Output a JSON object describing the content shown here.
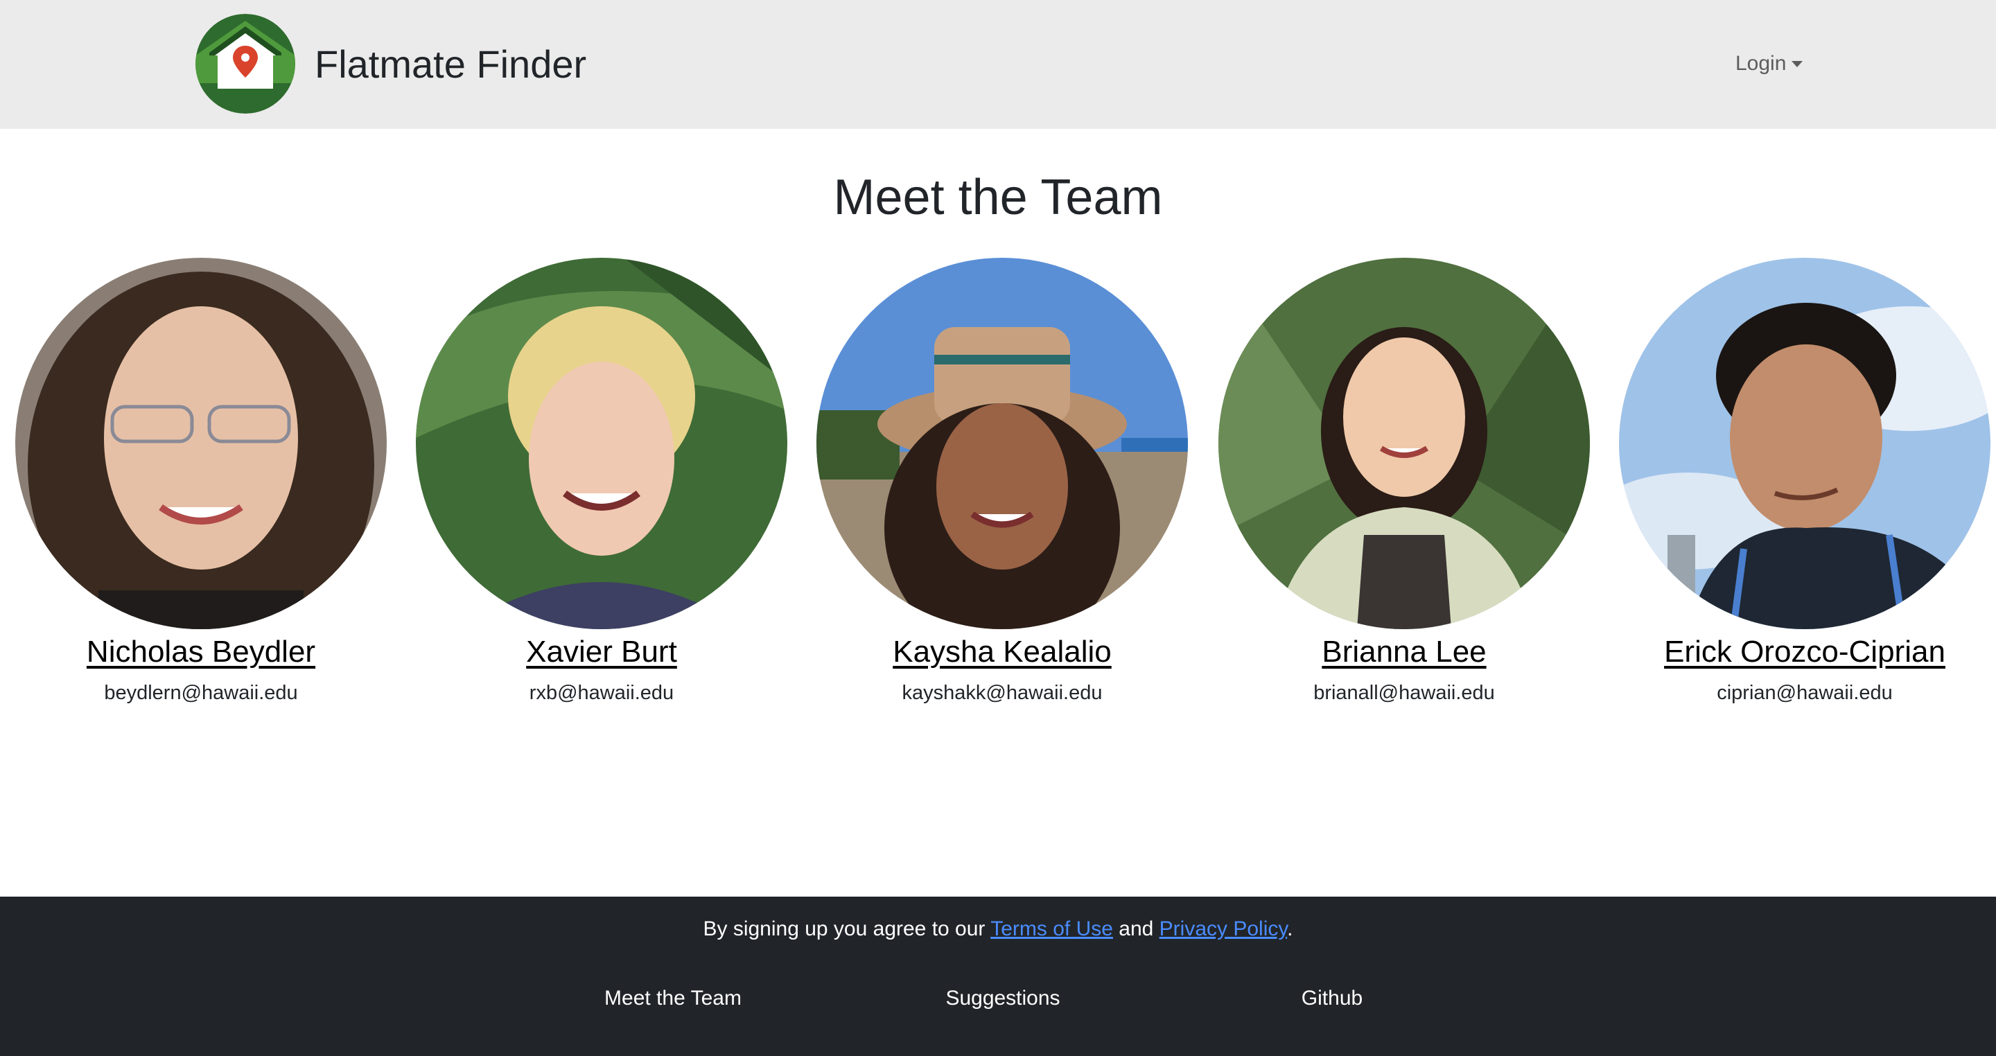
{
  "navbar": {
    "brand": "Flatmate Finder",
    "login_label": "Login"
  },
  "main": {
    "title": "Meet the Team",
    "members": [
      {
        "name": "Nicholas Beydler",
        "email": "beydlern@hawaii.edu"
      },
      {
        "name": "Xavier Burt",
        "email": "rxb@hawaii.edu"
      },
      {
        "name": "Kaysha Kealalio",
        "email": "kayshakk@hawaii.edu"
      },
      {
        "name": "Brianna Lee",
        "email": "brianall@hawaii.edu"
      },
      {
        "name": "Erick Orozco-Ciprian",
        "email": "ciprian@hawaii.edu"
      }
    ]
  },
  "footer": {
    "agree_prefix": "By signing up you agree to our ",
    "terms_label": "Terms of Use",
    "and_text": " and ",
    "privacy_label": "Privacy Policy",
    "period": ".",
    "links": [
      "Meet the Team",
      "Suggestions",
      "Github"
    ]
  },
  "colors": {
    "navbar_bg": "#ebebeb",
    "footer_bg": "#212529",
    "link_blue": "#4a8cff",
    "logo_green_dark": "#2e6b2e",
    "logo_green_light": "#4f9a3c",
    "pin_red": "#d9432c"
  }
}
